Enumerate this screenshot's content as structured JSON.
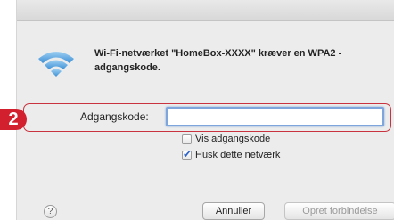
{
  "step_badge": "2",
  "dialog": {
    "message": "Wi-Fi-netværket \"HomeBox-XXXX\" kræver en WPA2 - adgangskode.",
    "password_label": "Adgangskode:",
    "password_value": "",
    "show_password_label": "Vis adgangskode",
    "show_password_checked": false,
    "remember_network_label": "Husk dette netværk",
    "remember_network_checked": true,
    "help_label": "?",
    "cancel_label": "Annuller",
    "connect_label": "Opret forbindelse",
    "wifi_icon": "wifi-icon",
    "accent_color": "#2e64c7",
    "highlight_color": "#c9333f"
  }
}
